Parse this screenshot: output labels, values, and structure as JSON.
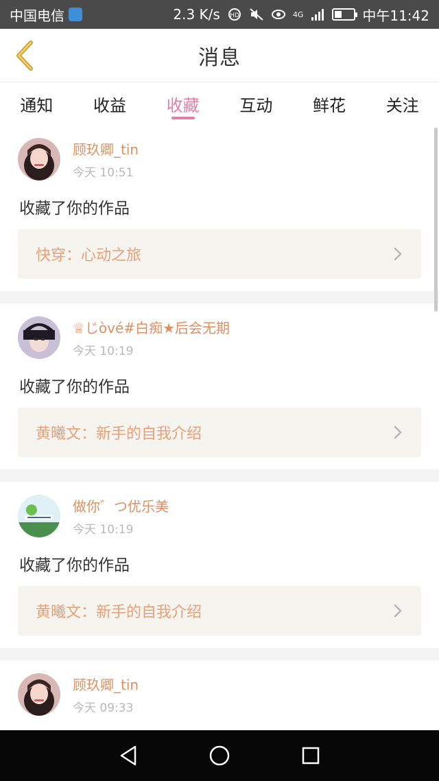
{
  "status_bar": {
    "carrier": "中国电信",
    "speed": "2.3 K/s",
    "network": "4G",
    "time": "中午11:42"
  },
  "header": {
    "title": "消息",
    "back_icon": "chevron-left-icon"
  },
  "tabs": [
    {
      "label": "通知",
      "active": false
    },
    {
      "label": "收益",
      "active": false
    },
    {
      "label": "收藏",
      "active": true
    },
    {
      "label": "互动",
      "active": false
    },
    {
      "label": "鲜花",
      "active": false
    },
    {
      "label": "关注",
      "active": false
    }
  ],
  "messages": [
    {
      "username": "顾玖卿_tin",
      "time": "今天 10:51",
      "action": "收藏了你的作品",
      "work": "快穿：心动之旅"
    },
    {
      "username": "♕じòvé#白痴★后会无期",
      "time": "今天 10:19",
      "action": "收藏了你的作品",
      "work": "黄曦文：新手的自我介绍"
    },
    {
      "username": "做你゛つ优乐美",
      "time": "今天 10:19",
      "action": "收藏了你的作品",
      "work": "黄曦文：新手的自我介绍"
    },
    {
      "username": "顾玖卿_tin",
      "time": "今天 09:33",
      "action": "",
      "work": ""
    }
  ],
  "colors": {
    "accent": "#e27fa9",
    "username": "#e08f61",
    "work_text": "#e6a07a",
    "back_icon": "#c9a23a"
  }
}
